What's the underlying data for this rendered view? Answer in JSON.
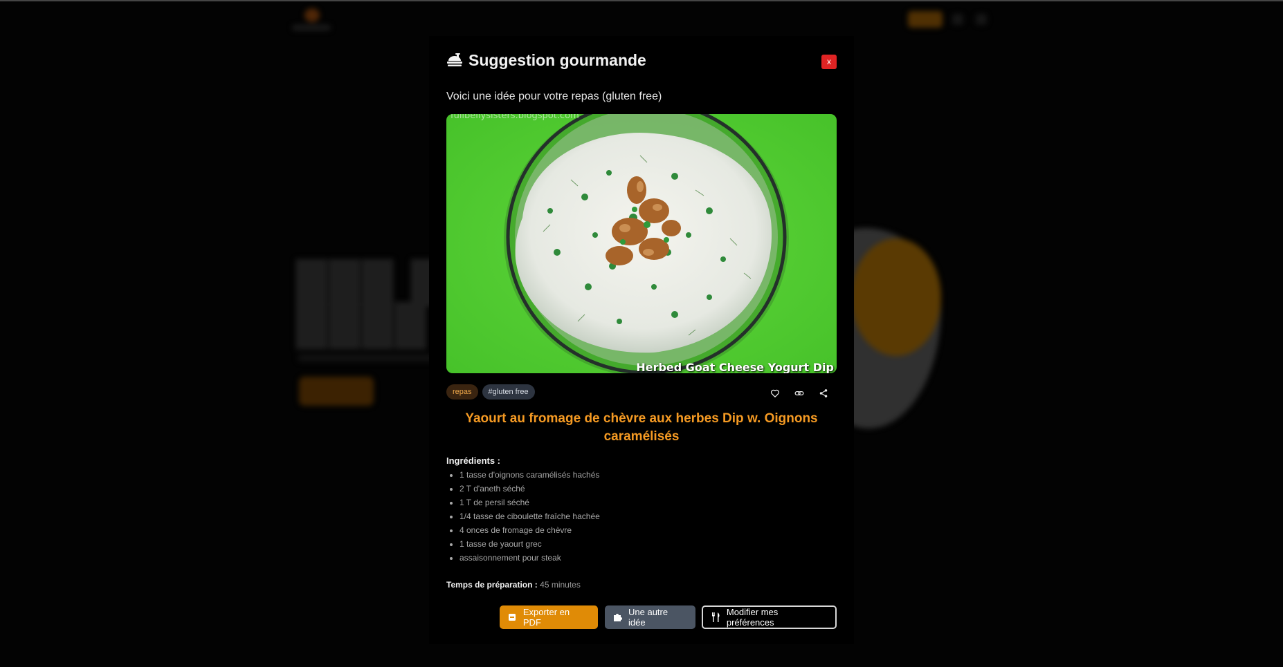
{
  "modal": {
    "title": "Suggestion gourmande",
    "close_label": "x",
    "intro": "Voici une idée pour votre repas (gluten free)"
  },
  "image": {
    "caption": "Herbed Goat Cheese Yogurt Dip",
    "watermark": "fullbellysisters.blogspot.com"
  },
  "tags": [
    "repas",
    "#gluten free"
  ],
  "recipe": {
    "title": "Yaourt au fromage de chèvre aux herbes Dip w. Oignons caramélisés",
    "ingredients_label": "Ingrédients :",
    "ingredients": [
      "1 tasse d'oignons caramélisés hachés",
      "2 T d'aneth séché",
      "1 T de persil séché",
      "1/4 tasse de ciboulette fraîche hachée",
      "4 onces de fromage de chèvre",
      "1 tasse de yaourt grec",
      "assaisonnement pour steak"
    ],
    "prep_label": "Temps de préparation :",
    "prep_value": "45 minutes"
  },
  "buttons": {
    "export_pdf": "Exporter en PDF",
    "another_idea": "Une autre idée",
    "preferences": "Modifier mes préférences"
  },
  "icons": {
    "title": "food-tray-icon",
    "favorite": "heart-icon",
    "link": "link-icon",
    "share": "share-icon",
    "pdf": "pdf-icon",
    "idea": "puzzle-icon",
    "preferences": "utensils-icon"
  },
  "colors": {
    "accent": "#f59a23",
    "close": "#e02424",
    "export_button": "#e08b06",
    "idea_button": "#4b5563"
  }
}
